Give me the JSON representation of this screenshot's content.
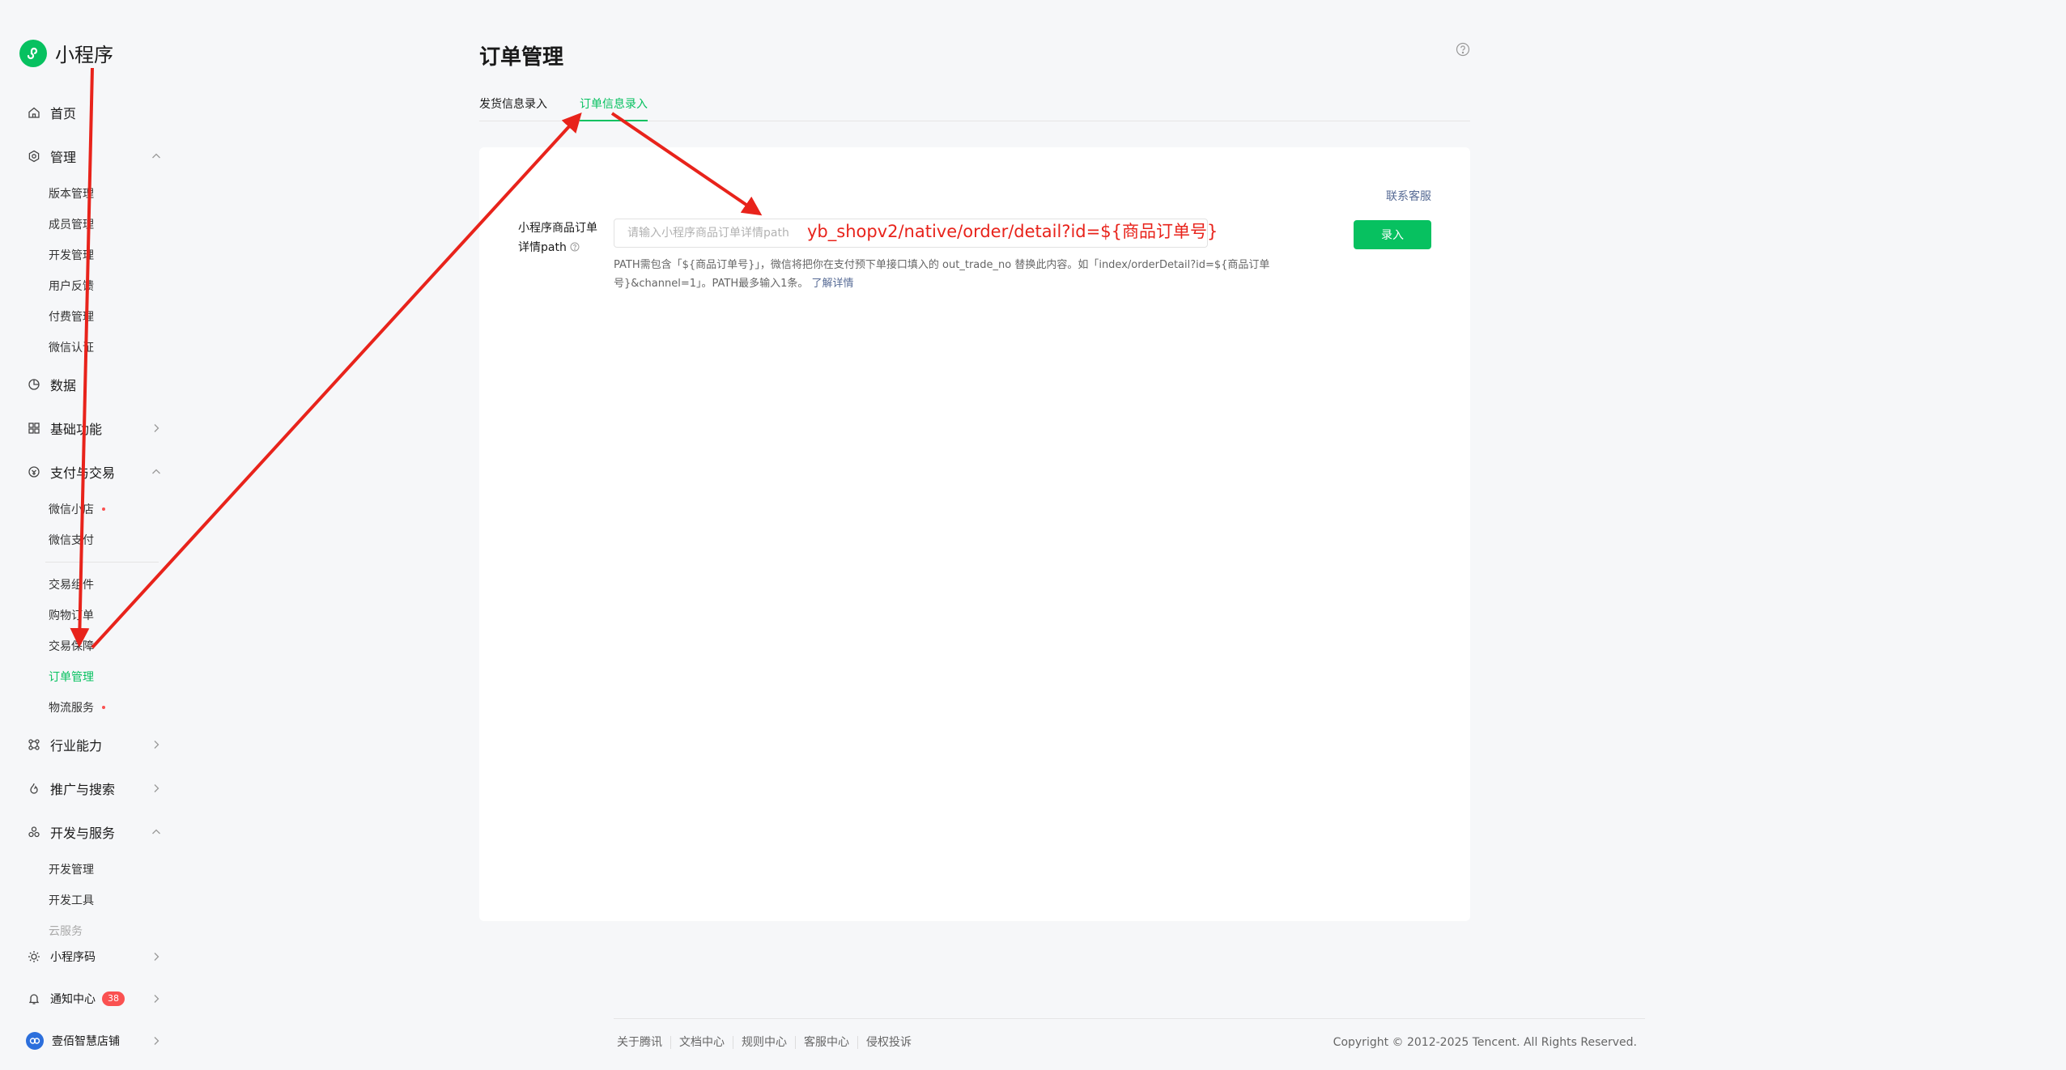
{
  "app": {
    "name": "小程序"
  },
  "sidebar": {
    "groups": [
      {
        "label": "首页",
        "icon": "home-icon"
      },
      {
        "label": "管理",
        "icon": "settings-icon",
        "expanded": true,
        "items": [
          "版本管理",
          "成员管理",
          "开发管理",
          "用户反馈",
          "付费管理",
          "微信认证"
        ]
      },
      {
        "label": "数据",
        "icon": "chart-pie-icon"
      },
      {
        "label": "基础功能",
        "icon": "grid-icon"
      },
      {
        "label": "支付与交易",
        "icon": "payment-icon",
        "expanded": true,
        "items": [
          "微信小店",
          "微信支付",
          "交易组件",
          "购物订单",
          "交易保障",
          "订单管理",
          "物流服务"
        ]
      },
      {
        "label": "行业能力",
        "icon": "industry-icon"
      },
      {
        "label": "推广与搜索",
        "icon": "promotion-icon"
      },
      {
        "label": "开发与服务",
        "icon": "dev-service-icon",
        "expanded": true,
        "items": [
          "开发管理",
          "开发工具",
          "云服务"
        ]
      }
    ],
    "active_item": "订单管理",
    "bottom": {
      "qrcode_label": "小程序码",
      "notification_label": "通知中心",
      "notification_count": "38",
      "account_label": "壹佰智慧店铺"
    }
  },
  "header": {
    "title": "订单管理",
    "tabs": [
      {
        "label": "发货信息录入",
        "active": false
      },
      {
        "label": "订单信息录入",
        "active": true
      }
    ]
  },
  "form": {
    "contact_link": "联系客服",
    "label": "小程序商品订单详情path",
    "input_placeholder": "请输入小程序商品订单详情path",
    "input_value": "",
    "submit_label": "录入",
    "hint_text": "PATH需包含「${商品订单号}」，微信将把你在支付预下单接口填入的 out_trade_no 替换此内容。如「index/orderDetail?id=${商品订单号}&channel=1」。PATH最多输入1条。",
    "hint_link": "了解详情"
  },
  "annotation": {
    "text": "yb_shopv2/native/order/detail?id=${商品订单号}",
    "color": "#e8231b"
  },
  "footer": {
    "links": [
      "关于腾讯",
      "文档中心",
      "规则中心",
      "客服中心",
      "侵权投诉"
    ],
    "copyright": "Copyright © 2012-2025 Tencent. All Rights Reserved."
  },
  "colors": {
    "accent": "#07c160",
    "link": "#576b95",
    "alert": "#fa5151"
  }
}
